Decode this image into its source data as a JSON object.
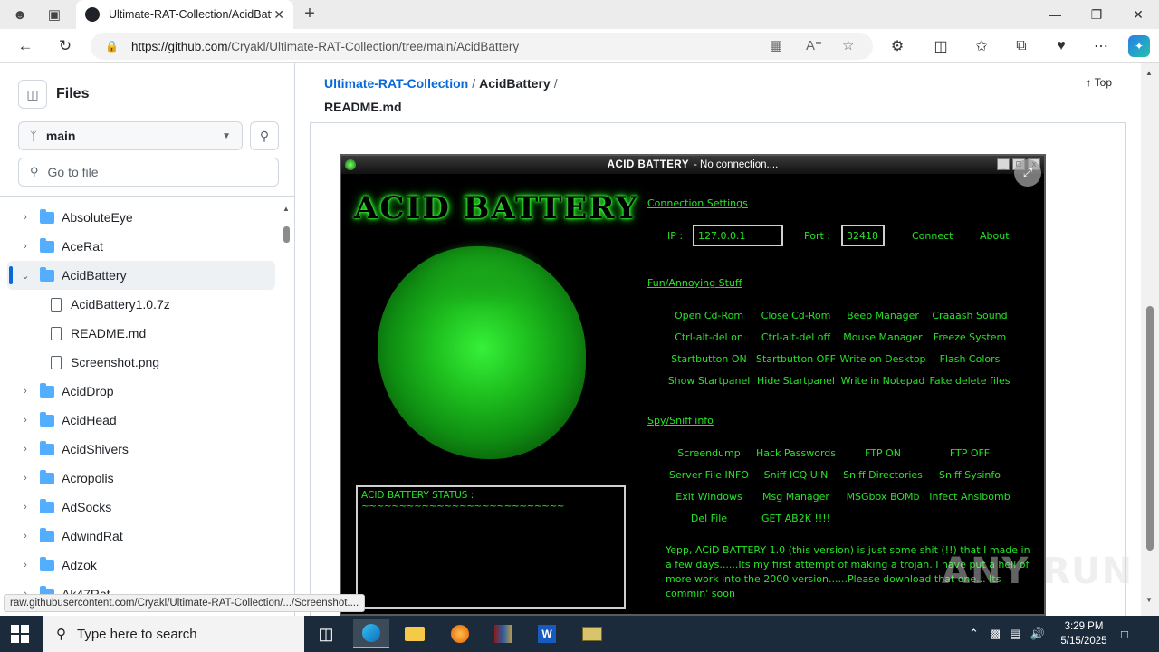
{
  "browser": {
    "tab_title": "Ultimate-RAT-Collection/AcidBattery",
    "url_host": "https://github.com",
    "url_path": "/Cryakl/Ultimate-RAT-Collection/tree/main/AcidBattery",
    "status_url": "raw.githubusercontent.com/Cryakl/Ultimate-RAT-Collection/.../Screenshot...."
  },
  "sidebar": {
    "title": "Files",
    "branch": "main",
    "goto_placeholder": "Go to file",
    "items": [
      {
        "label": "AbsoluteEye",
        "type": "folder"
      },
      {
        "label": "AceRat",
        "type": "folder"
      },
      {
        "label": "AcidBattery",
        "type": "folder-open"
      },
      {
        "label": "AcidBattery1.0.7z",
        "type": "file"
      },
      {
        "label": "README.md",
        "type": "file"
      },
      {
        "label": "Screenshot.png",
        "type": "file"
      },
      {
        "label": "AcidDrop",
        "type": "folder"
      },
      {
        "label": "AcidHead",
        "type": "folder"
      },
      {
        "label": "AcidShivers",
        "type": "folder"
      },
      {
        "label": "Acropolis",
        "type": "folder"
      },
      {
        "label": "AdSocks",
        "type": "folder"
      },
      {
        "label": "AdwindRat",
        "type": "folder"
      },
      {
        "label": "Adzok",
        "type": "folder"
      },
      {
        "label": "Ak47Rat",
        "type": "folder"
      }
    ]
  },
  "main": {
    "crumb_repo": "Ultimate-RAT-Collection",
    "crumb_sep": "/",
    "crumb_folder": "AcidBattery",
    "crumb_trail": "/",
    "top_label": "Top",
    "readme_label": "README.md"
  },
  "acid": {
    "title_bold": "ACID BATTERY",
    "title_rest": "- No connection....",
    "logo": "ACID BATTERY",
    "connection_heading": "Connection Settings",
    "ip_label": "IP :",
    "ip_value": "127.0.0.1",
    "port_label": "Port :",
    "port_value": "32418",
    "connect": "Connect",
    "about": "About",
    "fun_heading": "Fun/Annoying Stuff",
    "fun_items": [
      "Open Cd-Rom",
      "Close Cd-Rom",
      "Beep Manager",
      "Craaash Sound",
      "Ctrl-alt-del on",
      "Ctrl-alt-del off",
      "Mouse Manager",
      "Freeze System",
      "Startbutton ON",
      "Startbutton OFF",
      "Write on Desktop",
      "Flash Colors",
      "Show Startpanel",
      "Hide Startpanel",
      "Write in Notepad",
      "Fake delete files"
    ],
    "spy_heading": "Spy/Sniff info",
    "spy_items": [
      "Screendump",
      "Hack Passwords",
      "FTP ON",
      "FTP OFF",
      "Server File INFO",
      "Sniff ICQ UIN",
      "Sniff Directories",
      "Sniff Sysinfo",
      "Exit Windows",
      "Msg Manager",
      "MSGbox BOMb",
      "Infect Ansibomb",
      "Del File",
      "GET AB2K !!!!",
      "",
      ""
    ],
    "status_label": "ACID BATTERY STATUS :",
    "status_line": "~~~~~~~~~~~~~~~~~~~~~~~~~~~",
    "note": "Yepp, ACiD BATTERY 1.0 (this version) is just some shit (!!) that I made in a few days......Its my first attempt of making a trojan. I have put a hell of more work into the 2000 version......Please download that one... Its commin' soon"
  },
  "watermark": "ANY RUN",
  "taskbar": {
    "search_placeholder": "Type here to search",
    "time": "3:29 PM",
    "date": "5/15/2025"
  }
}
